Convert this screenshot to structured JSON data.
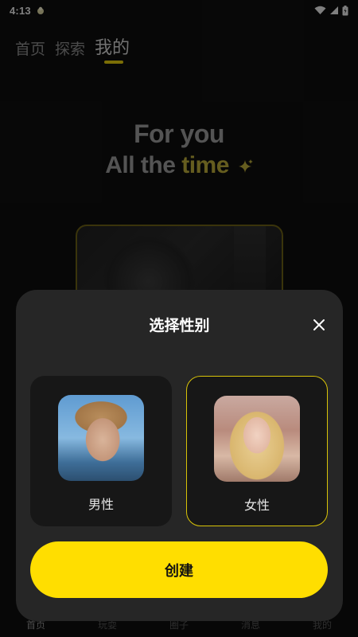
{
  "status": {
    "time": "4:13"
  },
  "top_tabs": [
    {
      "label": "首页",
      "active": false
    },
    {
      "label": "探索",
      "active": false
    },
    {
      "label": "我的",
      "active": true
    }
  ],
  "hero": {
    "line1": "For you",
    "line2_prefix": "All the ",
    "line2_accent": "time"
  },
  "bottom_nav": [
    "首页",
    "玩耍",
    "圈子",
    "消息",
    "我的"
  ],
  "sheet": {
    "title": "选择性别",
    "options": [
      {
        "label": "男性",
        "selected": false
      },
      {
        "label": "女性",
        "selected": true
      }
    ],
    "create_label": "创建"
  },
  "colors": {
    "accent": "#ffde00",
    "selected_border": "#d8c308",
    "sheet_bg": "#262626"
  }
}
